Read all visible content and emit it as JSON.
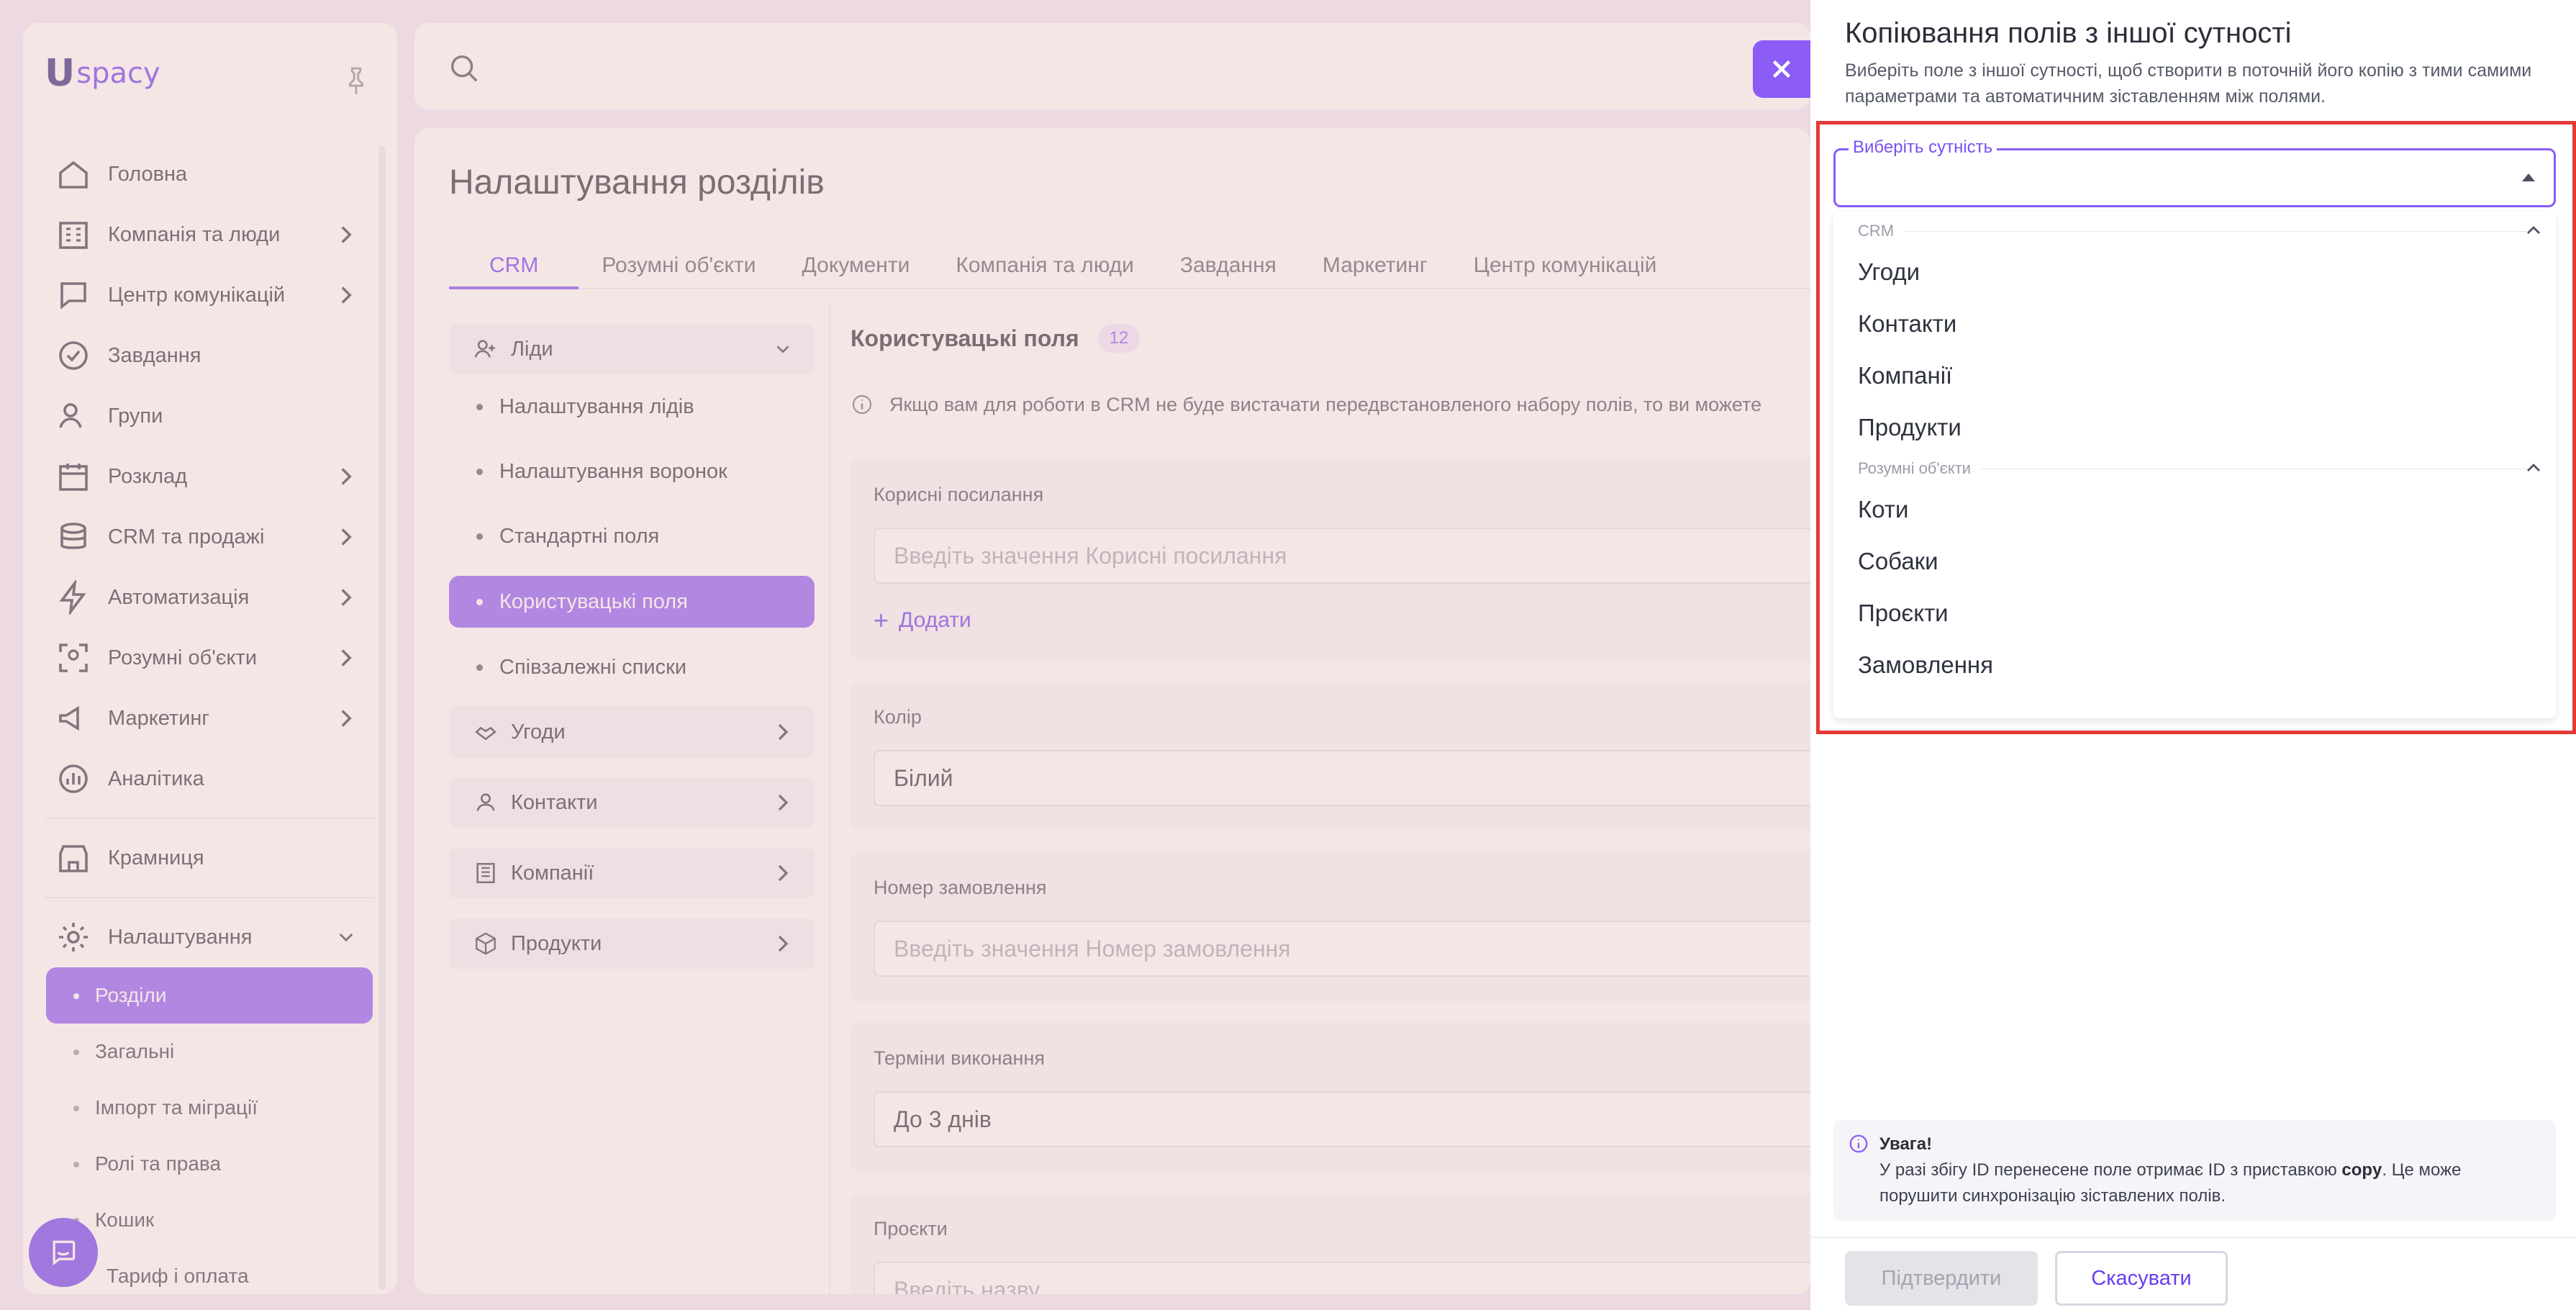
{
  "app": {
    "logo_mark": "U",
    "logo_word": "spacy"
  },
  "sidebar": {
    "items": [
      {
        "label": "Головна",
        "icon": "home-icon"
      },
      {
        "label": "Компанія та люди",
        "icon": "building-icon"
      },
      {
        "label": "Центр комунікацій",
        "icon": "chat-icon"
      },
      {
        "label": "Завдання",
        "icon": "check-circle-icon"
      },
      {
        "label": "Групи",
        "icon": "users-icon"
      },
      {
        "label": "Розклад",
        "icon": "calendar-icon"
      },
      {
        "label": "CRM та продажі",
        "icon": "database-icon"
      },
      {
        "label": "Автоматизація",
        "icon": "lightning-icon"
      },
      {
        "label": "Розумні об'єкти",
        "icon": "scan-icon"
      },
      {
        "label": "Маркетинг",
        "icon": "megaphone-icon"
      },
      {
        "label": "Аналітика",
        "icon": "chart-icon"
      }
    ],
    "store": "Крамниця",
    "settings": "Налаштування",
    "settings_sub": [
      "Розділи",
      "Загальні",
      "Імпорт та міграції",
      "Ролі та права",
      "Кошик"
    ],
    "tariff": "Тариф і оплата"
  },
  "main": {
    "title": "Налаштування розділів",
    "tabs": [
      "CRM",
      "Розумні об'єкти",
      "Документи",
      "Компанія та люди",
      "Завдання",
      "Маркетинг",
      "Центр комунікацій"
    ],
    "groups": {
      "leads": "Ліди",
      "leads_items": [
        "Налаштування лідів",
        "Налаштування воронок",
        "Стандартні поля",
        "Користувацькі поля",
        "Співзалежні списки"
      ],
      "deals": "Угоди",
      "contacts": "Контакти",
      "companies": "Компанії",
      "products": "Продукти"
    },
    "fields_title": "Користувацькі поля",
    "fields_count": "12",
    "info": "Якщо вам для роботи в CRM не буде вистачати передвстановленого набору полів, то ви можете",
    "fields": [
      {
        "label": "Корисні посилання",
        "value": "Введіть значення Корисні посилання",
        "placeholder": true
      },
      {
        "label": "Колір",
        "value": "Білий",
        "placeholder": false
      },
      {
        "label": "Номер замовлення",
        "value": "Введіть значення Номер замовлення",
        "placeholder": true
      },
      {
        "label": "Терміни виконання",
        "value": "До 3 днів",
        "placeholder": false
      },
      {
        "label": "Проєкти",
        "value": "Введіть назву",
        "placeholder": true
      }
    ],
    "add_label": "Додати"
  },
  "drawer": {
    "title": "Копіювання полів з іншої сутності",
    "subtitle": "Виберіть поле з іншої сутності, щоб створити в поточній його копію з тими самими параметрами та автоматичним зіставленням між полями.",
    "select_label": "Виберіть сутність",
    "groups": [
      {
        "name": "CRM",
        "options": [
          "Угоди",
          "Контакти",
          "Компанії",
          "Продукти"
        ]
      },
      {
        "name": "Розумні об'єкти",
        "options": [
          "Коти",
          "Собаки",
          "Проєкти",
          "Замовлення"
        ]
      }
    ],
    "notice_title": "Увага!",
    "notice_text_1": "У разі збігу ID перенесене поле отримає ID з приставкою",
    "notice_bold": "copy",
    "notice_text_2": ". Це може порушити синхронізацію зіставлених полів.",
    "confirm": "Підтвердити",
    "cancel": "Скасувати"
  },
  "colors": {
    "accent": "#8b5cf6",
    "highlight_border": "#e53935"
  }
}
